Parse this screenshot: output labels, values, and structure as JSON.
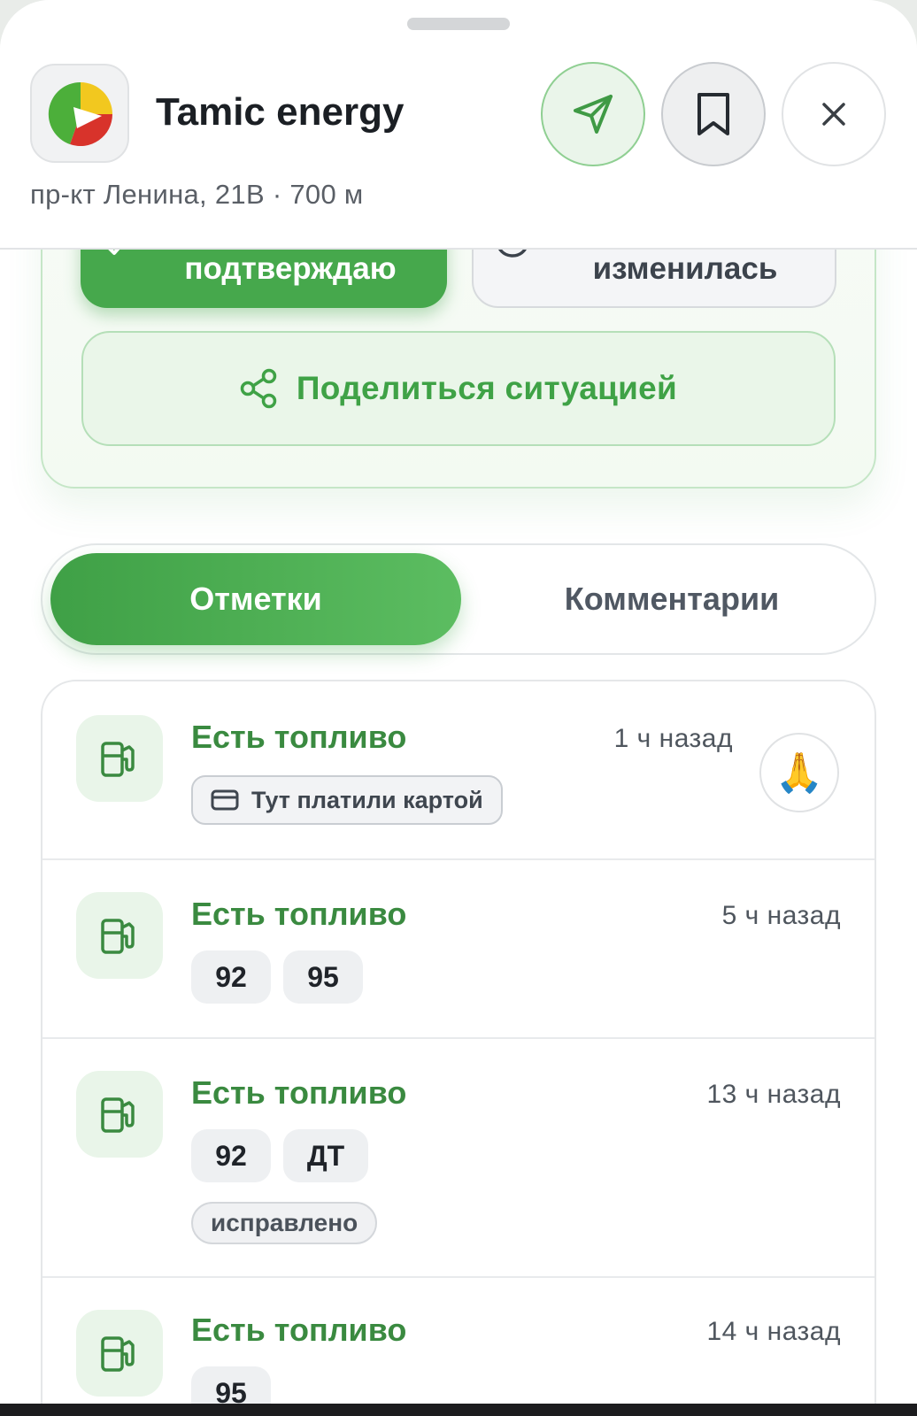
{
  "header": {
    "title": "Tamic energy",
    "address": "пр-кт Ленина, 21В",
    "distance": "700 м",
    "separator": " · "
  },
  "status_actions": {
    "confirm_label": "подтверждаю",
    "changed_label": "изменилась",
    "share_label": "Поделиться ситуацией"
  },
  "tabs": {
    "active": "Отметки",
    "inactive": "Комментарии"
  },
  "feed": [
    {
      "title": "Есть топливо",
      "time": "1 ч назад",
      "note": "Тут платили картой",
      "reaction": "🙏"
    },
    {
      "title": "Есть топливо",
      "time": "5 ч назад",
      "fuels": [
        "92",
        "95"
      ]
    },
    {
      "title": "Есть топливо",
      "time": "13 ч назад",
      "fuels": [
        "92",
        "ДТ"
      ],
      "tag": "исправлено"
    },
    {
      "title": "Есть топливо",
      "time": "14 ч назад",
      "fuels": [
        "95"
      ]
    }
  ],
  "colors": {
    "accent": "#46a84c",
    "title_green": "#3a8a40"
  },
  "icons": {
    "navigate": "navigation-arrow-icon",
    "bookmark": "bookmark-icon",
    "close": "close-icon",
    "share": "share-icon",
    "fuel": "fuel-pump-icon",
    "card": "credit-card-icon"
  }
}
